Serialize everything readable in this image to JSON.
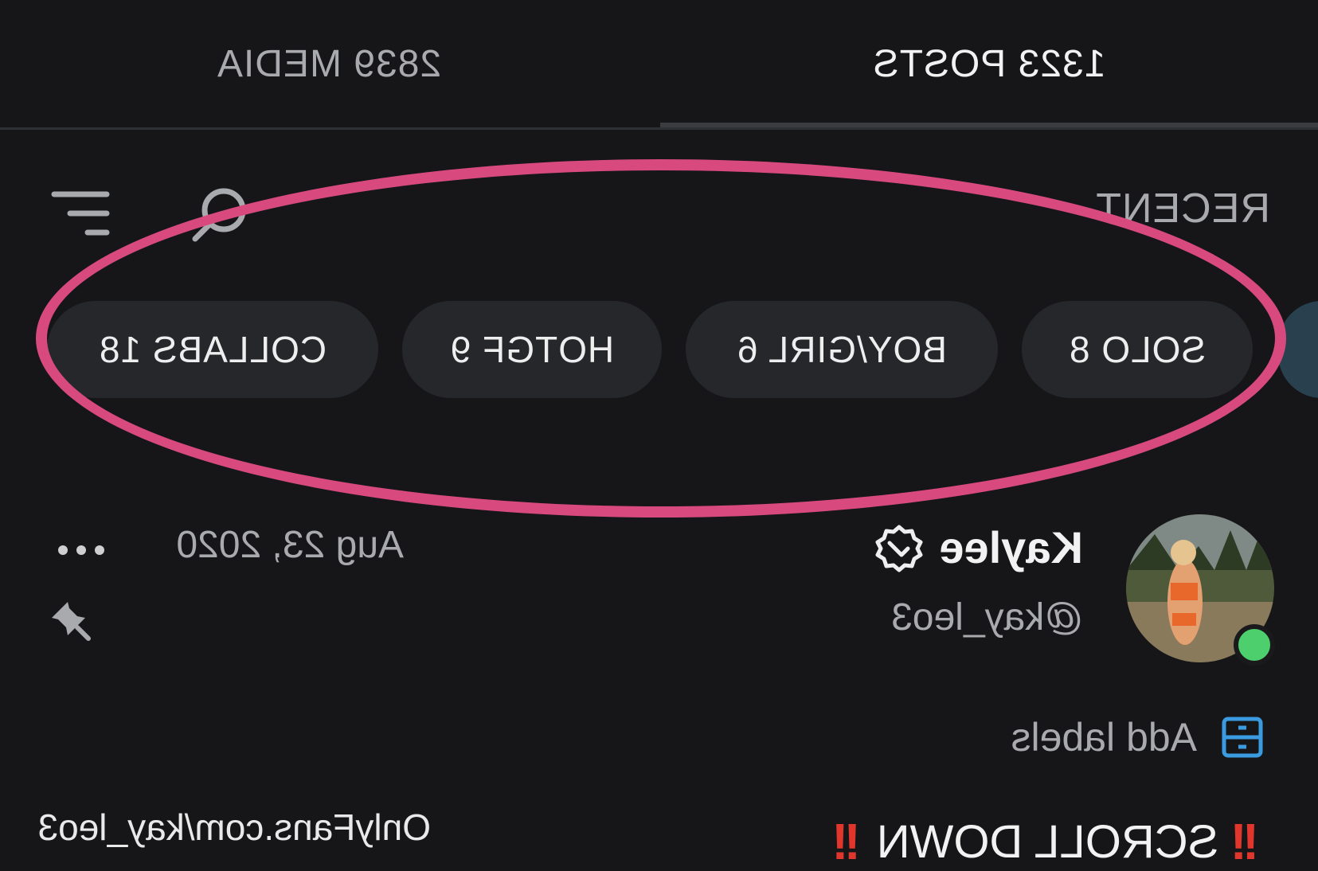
{
  "tabs": {
    "posts_label": "1323 POSTS",
    "media_label": "2839 MEDIA"
  },
  "toolbar": {
    "sort_label": "RECENT"
  },
  "chips": [
    {
      "label": "SOLO 8"
    },
    {
      "label": "BOY/GIRL 6"
    },
    {
      "label": "HOTGF 9"
    },
    {
      "label": "COLLABS 18"
    }
  ],
  "post": {
    "author_name": "Kaylee",
    "author_handle": "@kay_leo3",
    "date": "Aug 23, 2020",
    "add_labels": "Add labels",
    "body_text": "SCROLL DOWN",
    "excl": "!!",
    "link": "OnlyFans.com/kay_leo3"
  },
  "colors": {
    "background": "#161618",
    "chip_bg": "#26272b",
    "highlight": "#d84a7e",
    "online": "#4ccf6c",
    "accent_blue": "#3a9be0",
    "alert_red": "#e0362c"
  },
  "icons": [
    "search-icon",
    "filter-icon",
    "verified-icon",
    "more-icon",
    "pin-icon",
    "labels-icon"
  ]
}
